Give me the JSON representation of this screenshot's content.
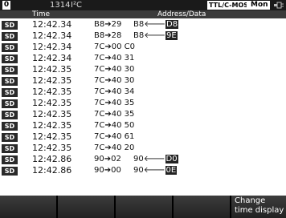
{
  "topbar": {
    "channel": "0",
    "count": "1314",
    "protocol": "I²C",
    "signal_mode": "TTL/C-MOS",
    "mode": "Mon"
  },
  "header": {
    "time": "Time",
    "address": "Address/Data"
  },
  "rows": [
    {
      "tag": "SD",
      "time": "12:42.34",
      "d1": "B8➔29",
      "d2": "B8🡐",
      "d2_hl": "D8"
    },
    {
      "tag": "SD",
      "time": "12:42.34",
      "d1": "B8➔28",
      "d2": "B8🡐",
      "d2_hl": "9E"
    },
    {
      "tag": "SD",
      "time": "12:42.34",
      "d1": "7C➔00 C0",
      "d2": "",
      "d2_hl": ""
    },
    {
      "tag": "SD",
      "time": "12:42.34",
      "d1": "7C➔40 31",
      "d2": "",
      "d2_hl": ""
    },
    {
      "tag": "SD",
      "time": "12:42.35",
      "d1": "7C➔40 30",
      "d2": "",
      "d2_hl": ""
    },
    {
      "tag": "SD",
      "time": "12:42.35",
      "d1": "7C➔40 30",
      "d2": "",
      "d2_hl": ""
    },
    {
      "tag": "SD",
      "time": "12:42.35",
      "d1": "7C➔40 34",
      "d2": "",
      "d2_hl": ""
    },
    {
      "tag": "SD",
      "time": "12:42.35",
      "d1": "7C➔40 35",
      "d2": "",
      "d2_hl": ""
    },
    {
      "tag": "SD",
      "time": "12:42.35",
      "d1": "7C➔40 35",
      "d2": "",
      "d2_hl": ""
    },
    {
      "tag": "SD",
      "time": "12:42.35",
      "d1": "7C➔40 50",
      "d2": "",
      "d2_hl": ""
    },
    {
      "tag": "SD",
      "time": "12:42.35",
      "d1": "7C➔40 61",
      "d2": "",
      "d2_hl": ""
    },
    {
      "tag": "SD",
      "time": "12:42.35",
      "d1": "7C➔40 20",
      "d2": "",
      "d2_hl": ""
    },
    {
      "tag": "SD",
      "time": "12:42.86",
      "d1": "90➔02",
      "d2": "90🡐",
      "d2_hl": "D0"
    },
    {
      "tag": "SD",
      "time": "12:42.86",
      "d1": "90➔00",
      "d2": "90🡐",
      "d2_hl": "0E"
    }
  ],
  "softkeys": [
    "",
    "",
    "",
    "",
    "Change\ntime display"
  ],
  "icons": {
    "interface": "plug-icon"
  }
}
